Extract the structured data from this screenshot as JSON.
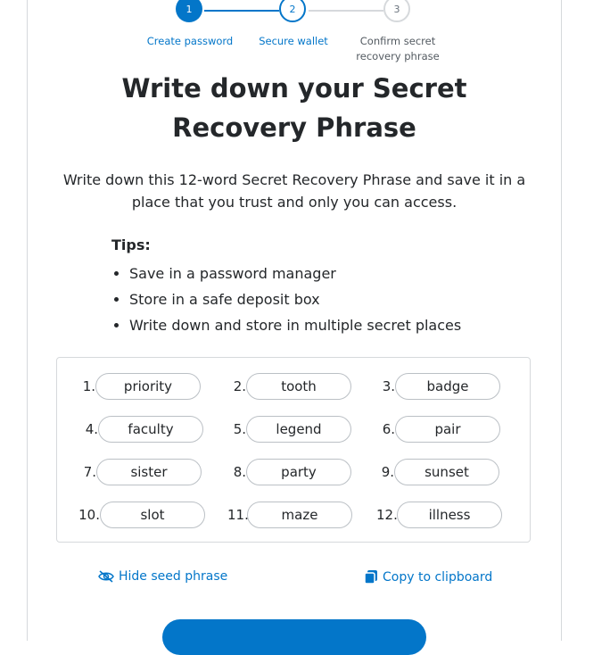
{
  "stepper": {
    "steps": [
      {
        "number": "1",
        "label": "Create password"
      },
      {
        "number": "2",
        "label": "Secure wallet"
      },
      {
        "number": "3",
        "label": "Confirm secret recovery phrase"
      }
    ]
  },
  "title": "Write down your Secret Recovery Phrase",
  "description": "Write down this 12-word Secret Recovery Phrase and save it in a place that you trust and only you can access.",
  "tips": {
    "heading": "Tips:",
    "items": [
      "Save in a password manager",
      "Store in a safe deposit box",
      "Write down and store in multiple secret places"
    ]
  },
  "phrase": [
    {
      "num": "1.",
      "word": "priority"
    },
    {
      "num": "2.",
      "word": "tooth"
    },
    {
      "num": "3.",
      "word": "badge"
    },
    {
      "num": "4.",
      "word": "faculty"
    },
    {
      "num": "5.",
      "word": "legend"
    },
    {
      "num": "6.",
      "word": "pair"
    },
    {
      "num": "7.",
      "word": "sister"
    },
    {
      "num": "8.",
      "word": "party"
    },
    {
      "num": "9.",
      "word": "sunset"
    },
    {
      "num": "10.",
      "word": "slot"
    },
    {
      "num": "11.",
      "word": "maze"
    },
    {
      "num": "12.",
      "word": "illness"
    }
  ],
  "actions": {
    "hide_label": "Hide seed phrase",
    "hide_icon": "eye-slash-icon",
    "copy_label": "Copy to clipboard",
    "copy_icon": "copy-icon"
  },
  "colors": {
    "accent": "#0376c9",
    "text": "#24272a",
    "border": "#d6d9dc"
  }
}
